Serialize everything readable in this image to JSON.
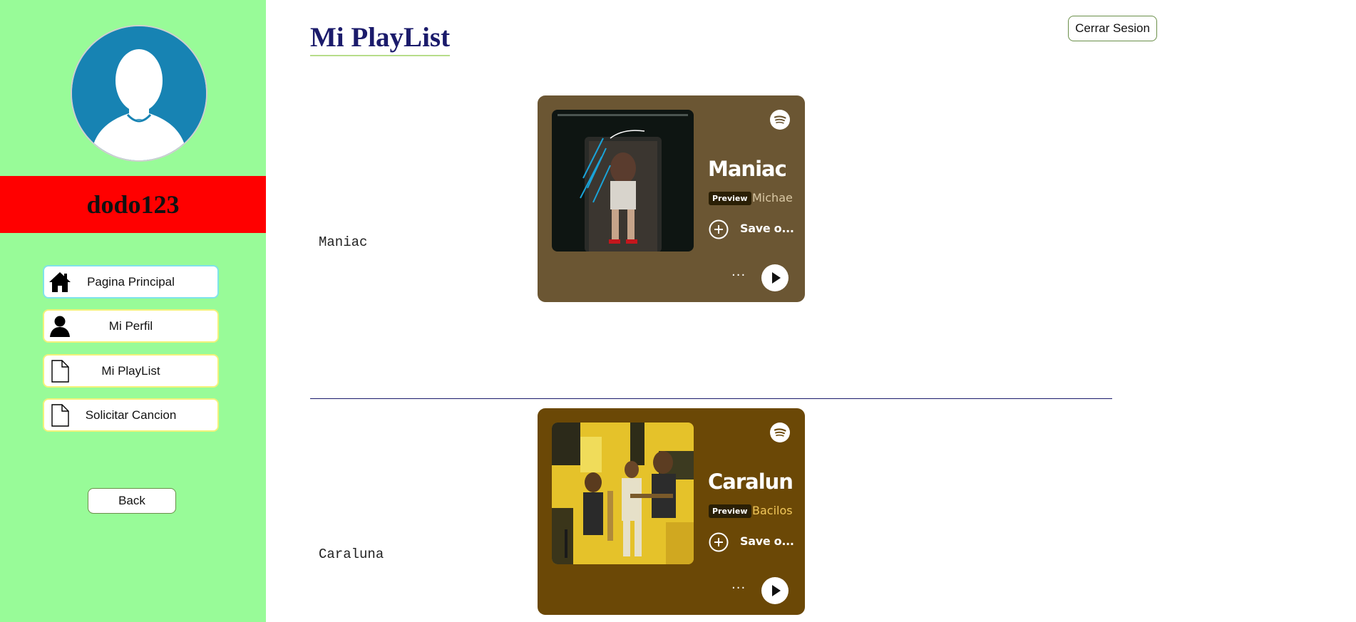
{
  "sidebar": {
    "username": "dodo123",
    "nav": [
      {
        "label": "Pagina Principal",
        "icon": "home-icon"
      },
      {
        "label": "Mi Perfil",
        "icon": "user-icon"
      },
      {
        "label": "Mi PlayList",
        "icon": "document-icon"
      },
      {
        "label": "Solicitar Cancion",
        "icon": "document-icon"
      }
    ],
    "back_label": "Back"
  },
  "header": {
    "title": "Mi PlayList",
    "logout_label": "Cerrar Sesion"
  },
  "playlist": [
    {
      "song": "Maniac",
      "embed": {
        "track": "Maniac",
        "badge": "Preview",
        "artist": "Michael Sembello",
        "save_label": "Save o...",
        "more_label": "···",
        "bg_color": "#6b5633",
        "artist_color": "#d9c8a5"
      }
    },
    {
      "song": "Caraluna",
      "embed": {
        "track": "Caraluna",
        "badge": "Preview",
        "artist": "Bacilos",
        "save_label": "Save o...",
        "more_label": "···",
        "bg_color": "#6b4806",
        "artist_color": "#f1c75a"
      }
    }
  ],
  "colors": {
    "sidebar_bg": "#98fb98",
    "user_band": "#ff0000",
    "title": "#1b1b6b",
    "avatar": "#1783b3"
  }
}
